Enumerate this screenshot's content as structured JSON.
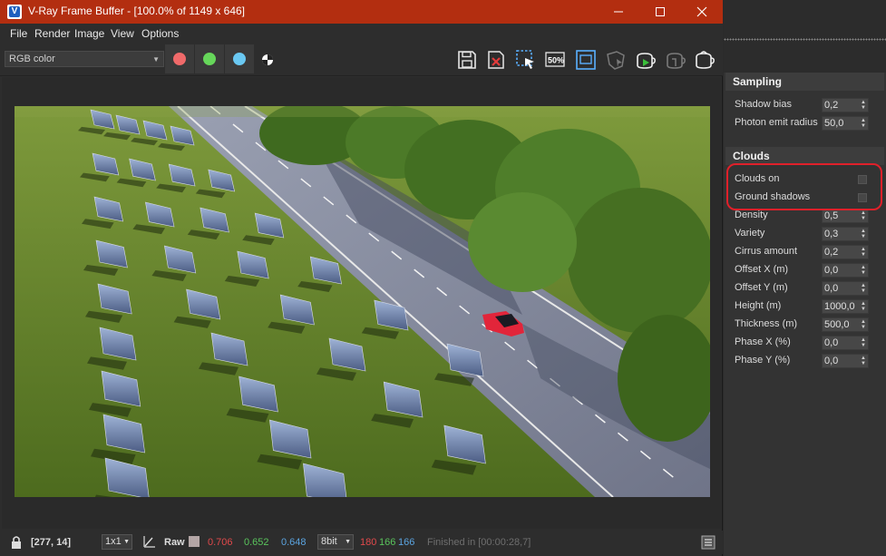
{
  "window": {
    "title": "V-Ray Frame Buffer - [100.0% of 1149 x 646]",
    "app_icon_letter": "V"
  },
  "menu": [
    "File",
    "Render",
    "Image",
    "View",
    "Options"
  ],
  "toolbar": {
    "channel": "RGB color",
    "swatches": [
      {
        "name": "red-channel",
        "color": "#f06a6a"
      },
      {
        "name": "green-channel",
        "color": "#66d65a"
      },
      {
        "name": "blue-channel",
        "color": "#6ac8f2"
      }
    ],
    "icons": [
      "save-image-icon",
      "clear-image-icon",
      "region-render-icon",
      "follow-mouse-icon",
      "show-corrections-icon",
      "track-mouse-icon",
      "render-icon",
      "interactive-render-icon",
      "render-last-icon"
    ],
    "region_label": "50%"
  },
  "status": {
    "coords": "[277, 14]",
    "zoom": "1x1",
    "raw_label": "Raw",
    "r": "0.706",
    "g": "0.652",
    "b": "0.648",
    "bitdepth": "8bit",
    "r8": "180",
    "g8": "166",
    "b8": "166",
    "finished": "Finished in [00:00:28,7]"
  },
  "panel": {
    "sampling": {
      "title": "Sampling",
      "params": [
        {
          "label": "Shadow bias",
          "value": "0,2"
        },
        {
          "label": "Photon emit radius",
          "value": "50,0"
        }
      ]
    },
    "clouds": {
      "title": "Clouds",
      "checks": [
        {
          "label": "Clouds on"
        },
        {
          "label": "Ground shadows"
        }
      ],
      "params": [
        {
          "label": "Density",
          "value": "0,5"
        },
        {
          "label": "Variety",
          "value": "0,3"
        },
        {
          "label": "Cirrus amount",
          "value": "0,2"
        },
        {
          "label": "Offset X (m)",
          "value": "0,0"
        },
        {
          "label": "Offset Y (m)",
          "value": "0,0"
        },
        {
          "label": "Height (m)",
          "value": "1000,0"
        },
        {
          "label": "Thickness (m)",
          "value": "500,0"
        },
        {
          "label": "Phase X (%)",
          "value": "0,0"
        },
        {
          "label": "Phase Y (%)",
          "value": "0,0"
        }
      ]
    }
  },
  "colors": {
    "titlebar": "#b32e10",
    "status_red": "#e0494b",
    "status_green": "#59c45c",
    "status_blue": "#5ba4e0",
    "annotation_red": "#e0202a",
    "car": "#e2253a"
  }
}
